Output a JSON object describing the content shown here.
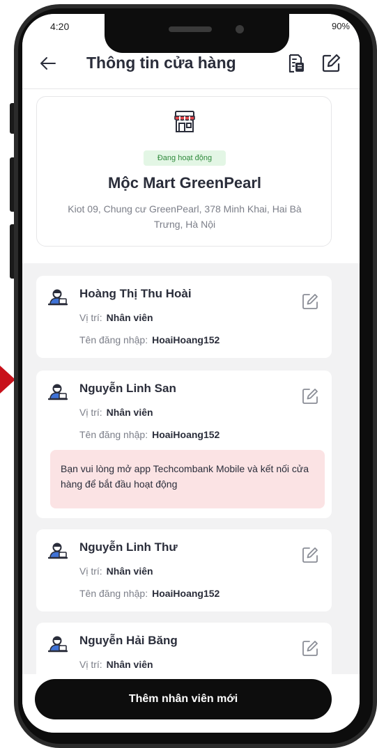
{
  "status_bar": {
    "time": "4:20",
    "battery": "90%"
  },
  "header": {
    "title": "Thông tin cửa hàng",
    "back_icon": "arrow-left-icon",
    "document_icon": "document-icon",
    "edit_icon": "edit-icon"
  },
  "store": {
    "status": "Đang hoạt động",
    "name": "Mộc Mart GreenPearl",
    "address": "Kiot 09, Chung cư GreenPearl, 378 Minh Khai, Hai Bà Trưng, Hà Nội"
  },
  "employees": [
    {
      "name": "Hoàng Thị Thu Hoài",
      "role_label": "Vị trí:",
      "role": "Nhân viên",
      "login_label": "Tên đăng nhập:",
      "login": "HoaiHoang152"
    },
    {
      "name": "Nguyễn Linh San",
      "role_label": "Vị trí:",
      "role": "Nhân viên",
      "login_label": "Tên đăng nhập:",
      "login": "HoaiHoang152",
      "warning": "Bạn vui lòng mở app Techcombank Mobile và kết nối cửa hàng để bắt đầu hoạt động"
    },
    {
      "name": "Nguyễn Linh Thư",
      "role_label": "Vị trí:",
      "role": "Nhân viên",
      "login_label": "Tên đăng nhập:",
      "login": "HoaiHoang152"
    },
    {
      "name": "Nguyễn Hải Băng",
      "role_label": "Vị trí:",
      "role": "Nhân viên"
    }
  ],
  "cta": {
    "label": "Thêm nhân viên mới"
  },
  "colors": {
    "accent_dark": "#0d0d0d",
    "status_green": "#2f8a3c",
    "warning_bg": "#fbe3e4",
    "arrow_red": "#c8101a"
  }
}
